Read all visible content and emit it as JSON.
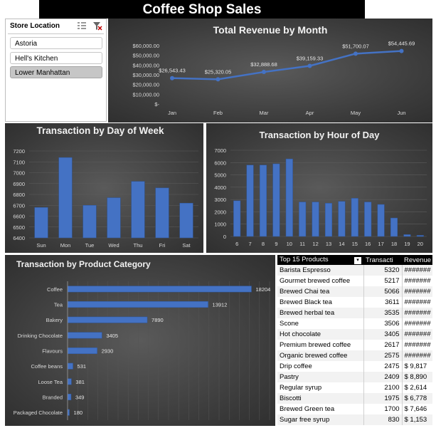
{
  "title": "Coffee Shop Sales",
  "slicer": {
    "header": "Store Location",
    "items": [
      "Astoria",
      "Hell's Kitchen",
      "Lower Manhattan"
    ],
    "selected_index": 2,
    "icons": [
      "multi-select-icon",
      "clear-filter-icon"
    ]
  },
  "charts": {
    "revenue": {
      "title": "Total Revenue by Month",
      "type": "line",
      "categories": [
        "Jan",
        "Feb",
        "Mar",
        "Apr",
        "May",
        "Jun"
      ],
      "values": [
        26543.43,
        25320.05,
        32888.68,
        39159.33,
        51700.07,
        54445.69
      ],
      "labels": [
        "$26,543.43",
        "$25,320.05",
        "$32,888.68",
        "$39,159.33",
        "$51,700.07",
        "$54,445.69"
      ],
      "yticks": [
        "$-",
        "$10,000.00",
        "$20,000.00",
        "$30,000.00",
        "$40,000.00",
        "$50,000.00",
        "$60,000.00"
      ],
      "ylim": [
        0,
        60000
      ],
      "color": "#4472c4"
    },
    "day": {
      "title": "Transaction by Day of Week",
      "type": "bar",
      "categories": [
        "Sun",
        "Mon",
        "Tue",
        "Wed",
        "Thu",
        "Fri",
        "Sat"
      ],
      "values": [
        6680,
        7140,
        6700,
        6770,
        6920,
        6860,
        6720
      ],
      "yticks": [
        "6400",
        "6500",
        "6600",
        "6700",
        "6800",
        "6900",
        "7000",
        "7100",
        "7200"
      ],
      "ylim": [
        6400,
        7200
      ],
      "color": "#4472c4"
    },
    "hour": {
      "title": "Transaction by Hour of Day",
      "type": "bar",
      "categories": [
        "6",
        "7",
        "8",
        "9",
        "10",
        "11",
        "12",
        "13",
        "14",
        "15",
        "16",
        "17",
        "18",
        "19",
        "20"
      ],
      "values": [
        2900,
        5800,
        5800,
        5900,
        6300,
        2800,
        2800,
        2700,
        2850,
        3100,
        2800,
        2600,
        1500,
        150,
        90
      ],
      "yticks": [
        "0",
        "1000",
        "2000",
        "3000",
        "4000",
        "5000",
        "6000",
        "7000"
      ],
      "ylim": [
        0,
        7000
      ],
      "color": "#4472c4"
    },
    "category": {
      "title": "Transaction by Product Category",
      "type": "bar",
      "categories": [
        "Coffee",
        "Tea",
        "Bakery",
        "Drinking Chocolate",
        "Flavours",
        "Coffee beans",
        "Loose Tea",
        "Branded",
        "Packaged Chocolate"
      ],
      "values": [
        18204,
        13912,
        7890,
        3405,
        2930,
        531,
        381,
        349,
        180
      ],
      "labels": [
        "18204",
        "13912",
        "7890",
        "3405",
        "2930",
        "531",
        "381",
        "349",
        "180"
      ],
      "xlim": [
        0,
        20000
      ],
      "color": "#4472c4"
    }
  },
  "top_products": {
    "headers": [
      "Top 15 Products",
      "Transacti",
      "Revenue"
    ],
    "rows": [
      [
        "Barista Espresso",
        "5320",
        "#######"
      ],
      [
        "Gourmet brewed coffee",
        "5217",
        "#######"
      ],
      [
        "Brewed Chai tea",
        "5066",
        "#######"
      ],
      [
        "Brewed Black tea",
        "3611",
        "#######"
      ],
      [
        "Brewed herbal tea",
        "3535",
        "#######"
      ],
      [
        "Scone",
        "3506",
        "#######"
      ],
      [
        "Hot chocolate",
        "3405",
        "#######"
      ],
      [
        "Premium brewed coffee",
        "2617",
        "#######"
      ],
      [
        "Organic brewed coffee",
        "2575",
        "#######"
      ],
      [
        "Drip coffee",
        "2475",
        "$ 9,817"
      ],
      [
        "Pastry",
        "2409",
        "$ 8,890"
      ],
      [
        "Regular syrup",
        "2100",
        "$ 2,614"
      ],
      [
        "Biscotti",
        "1975",
        "$ 6,778"
      ],
      [
        "Brewed Green tea",
        "1700",
        "$ 7,646"
      ],
      [
        "Sugar free syrup",
        "830",
        "$ 1,153"
      ]
    ],
    "filter_icon": "filter-dropdown-icon"
  }
}
